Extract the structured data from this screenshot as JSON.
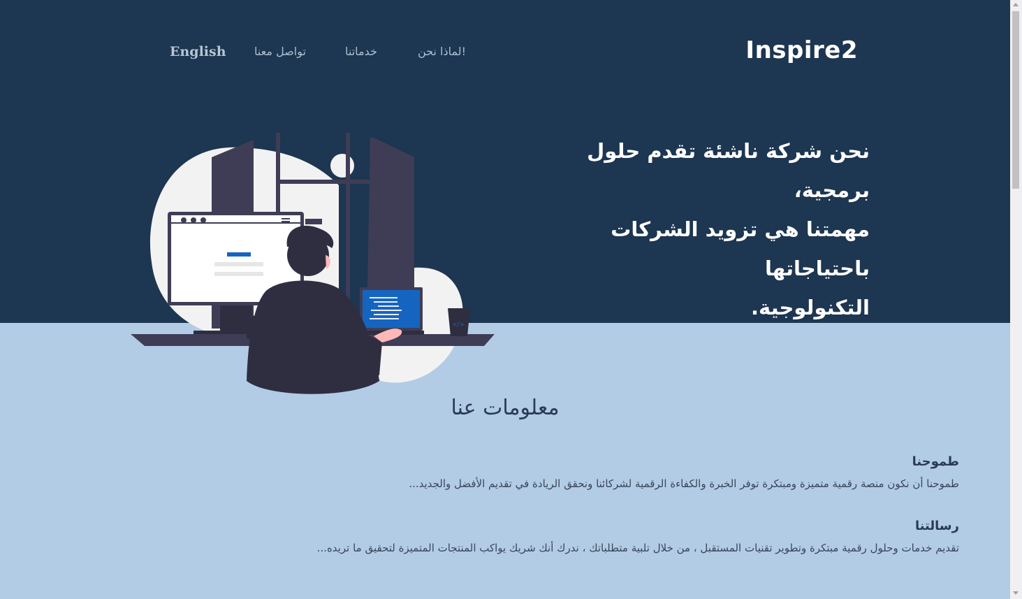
{
  "brand": "Inspire2",
  "nav": {
    "why_us": "لماذا نحن!",
    "services": "خدماتنا",
    "contact": "تواصل معنا",
    "language": "English"
  },
  "hero": {
    "line1": "نحن شركة ناشئة تقدم حلول برمجية،",
    "line2": "مهمتنا هي تزويد الشركات باحتياجاتها",
    "line3": "التكنولوجية."
  },
  "about": {
    "title": "معلومات عنا",
    "ambition": {
      "heading": "طموحنا",
      "text": "طموحنا أن نكون منصة رقمية متميزة ومبتكرة توفر الخبرة والكفاءة الرقمية لشركائنا ونحقق الريادة في تقديم الأفضل والجديد..."
    },
    "mission": {
      "heading": "رسالتنا",
      "text": "تقديم خدمات وحلول رقمية مبتكرة وتطوير تقنيات المستقبل ، من خلال تلبية متطلباتك ، ندرك أنك شريك يواكب المنتجات المتميزة لتحقيق ما تريده..."
    }
  },
  "colors": {
    "hero_bg": "#1d3651",
    "lower_bg": "#b2cce6",
    "text_dark": "#2a3a55",
    "accent_blue": "#1565c0"
  },
  "icons": [
    "developer-illustration",
    "code-icon"
  ]
}
